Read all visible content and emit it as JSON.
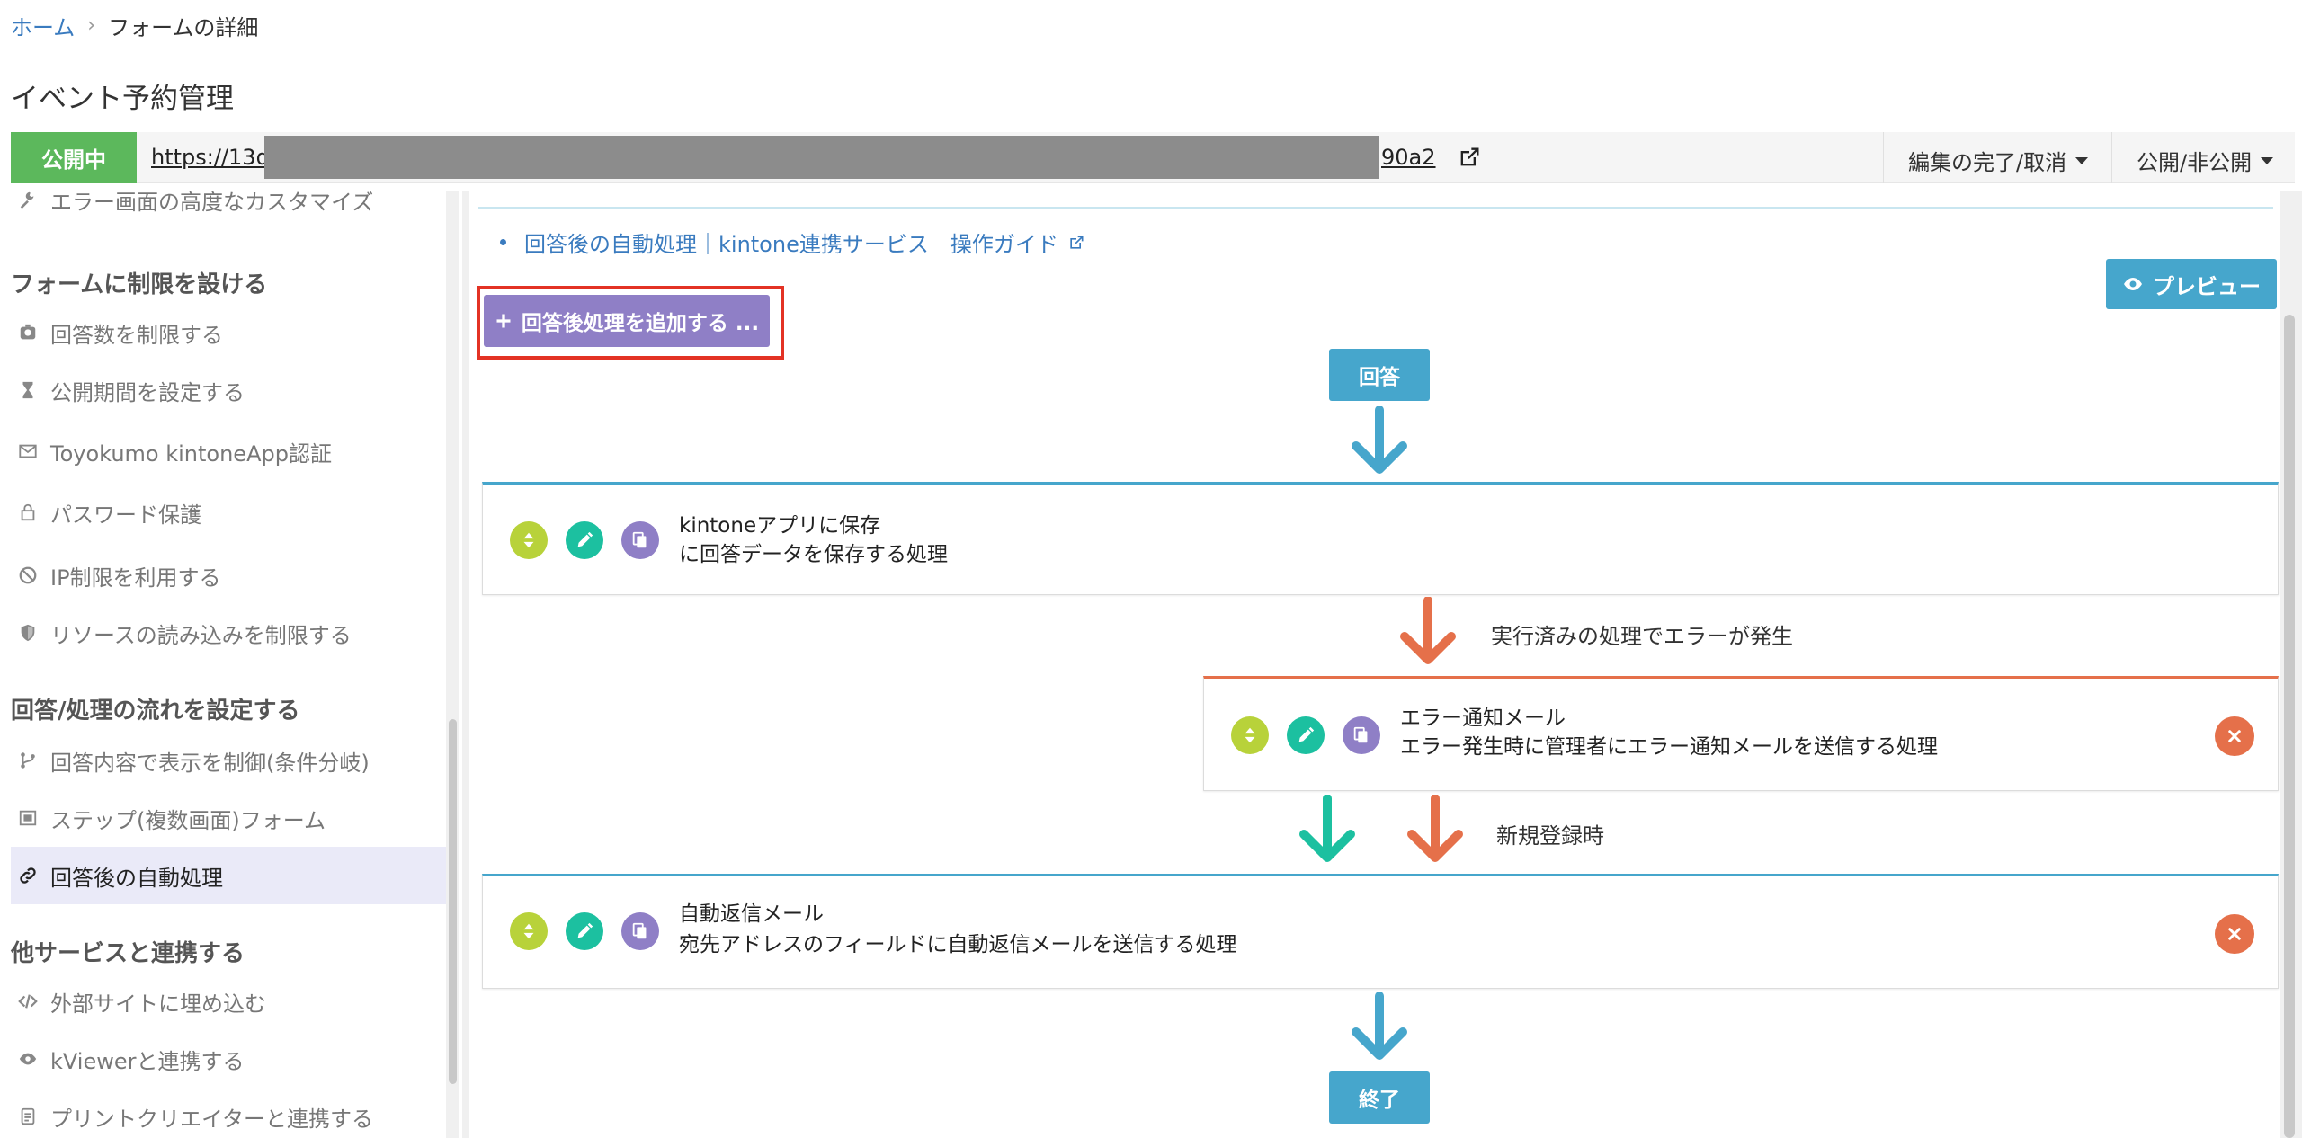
{
  "breadcrumb": {
    "home": "ホーム",
    "separator": "›",
    "current": "フォームの詳細"
  },
  "page_title": "イベント予約管理",
  "urlbar": {
    "status": "公開中",
    "url_prefix": "https://13d",
    "url_suffix": "90a2",
    "edit_menu": "編集の完了/取消",
    "publish_menu": "公開/非公開"
  },
  "sidebar": {
    "partial_item": "エラー画面の高度なカスタマイズ",
    "sections": [
      {
        "title": "フォームに制限を設ける",
        "items": [
          {
            "label": "回答数を制限する",
            "icon": "counter-icon"
          },
          {
            "label": "公開期間を設定する",
            "icon": "hourglass-icon"
          },
          {
            "label": "Toyokumo kintoneApp認証",
            "icon": "mail-icon"
          },
          {
            "label": "パスワード保護",
            "icon": "lock-icon"
          },
          {
            "label": "IP制限を利用する",
            "icon": "ban-icon"
          },
          {
            "label": "リソースの読み込みを制限する",
            "icon": "shield-icon"
          }
        ]
      },
      {
        "title": "回答/処理の流れを設定する",
        "items": [
          {
            "label": "回答内容で表示を制御(条件分岐)",
            "icon": "branch-icon"
          },
          {
            "label": "ステップ(複数画面)フォーム",
            "icon": "steps-icon"
          },
          {
            "label": "回答後の自動処理",
            "icon": "link-icon",
            "active": true
          }
        ]
      },
      {
        "title": "他サービスと連携する",
        "items": [
          {
            "label": "外部サイトに埋め込む",
            "icon": "code-icon"
          },
          {
            "label": "kViewerと連携する",
            "icon": "eye-icon"
          },
          {
            "label": "プリントクリエイターと連携する",
            "icon": "document-icon"
          }
        ]
      }
    ]
  },
  "main": {
    "guide_link": "回答後の自動処理｜kintone連携サービス　操作ガイド",
    "preview_button": "プレビュー",
    "add_button": "回答後処理を追加する ...",
    "flow_start": "回答",
    "flow_end": "終了",
    "cards": [
      {
        "title": "kintoneアプリに保存",
        "description": "に回答データを保存する処理"
      },
      {
        "title": "エラー通知メール",
        "description": "エラー発生時に管理者にエラー通知メールを送信する処理"
      },
      {
        "title": "自動返信メール",
        "description": "宛先アドレスのフィールドに自動返信メールを送信する処理"
      }
    ],
    "error_label": "実行済みの処理でエラーが発生",
    "new_record_label": "新規登録時"
  },
  "colors": {
    "accent_blue": "#46a6cc",
    "accent_orange": "#e5704a",
    "accent_green_arrow": "#1cc0a0",
    "accent_purple": "#8f7fc6",
    "status_green": "#5cb85c",
    "highlight_red": "#e33224"
  }
}
